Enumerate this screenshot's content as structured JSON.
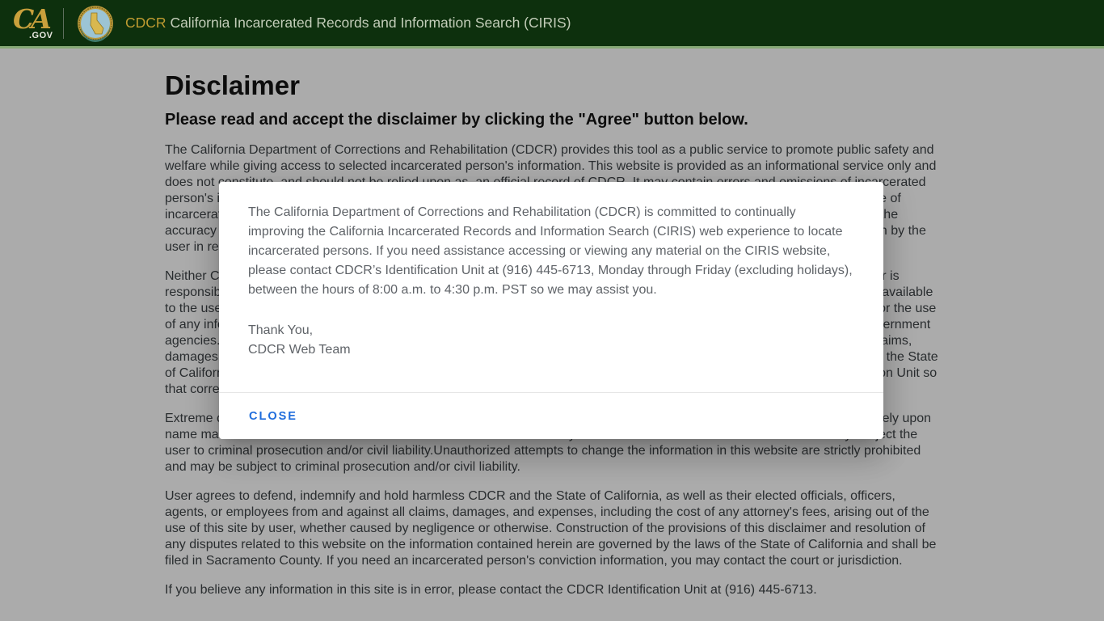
{
  "colors": {
    "header_bg": "#0d300d",
    "header_border": "#86a876",
    "accent_gold": "#bf9b31",
    "brand_text": "#c3cdb9",
    "close_blue": "#1f6ddc"
  },
  "header": {
    "ca_logo_script": "CA",
    "ca_logo_suffix": ".GOV",
    "brand_prefix": "CDCR",
    "brand_title": "California Incarcerated Records and Information Search (CIRIS)"
  },
  "page": {
    "title": "Disclaimer",
    "subtitle": "Please read and accept the disclaimer by clicking the \"Agree\" button below.",
    "paragraphs": [
      "The California Department of Corrections and Rehabilitation (CDCR) provides this tool as a public service to promote public safety and welfare while giving access to selected incarcerated person's information. This website is provided as an informational service only and does not constitute, and should not be relied upon as, an official record of CDCR. It may contain errors and omissions of incarcerated person's information, including but not limited to conviction county, admitted date, current location, and scheduled release date of incarcerated persons. While CDCR attempts to keep this information accurate and current, CDCR makes no guarantee as to the accuracy or completeness of the information provided herein, and assumes no liability for any decisions made or actions taken by the user in reliance upon the information contained in this website.",
      "Neither CDCR nor the State of California guarantees the accuracy, completeness, or timeliness of this information, and neither is responsible for any defects, errors, or omissions in this website or in the information that it provides. This information is made available to the user as is, without warranty of any kind, and by using this website the user shall assume all responsibility and all risks for the use of any information found herein. Any data collected, given at the consent of the user, may be shared with other authorized government agencies. CDCR, the State of California, and their elected officials, officers, agents, or employees shall not be liable for any claims, damages, or losses arising out of the use of, or the inability to use, this website. These provisions are governed by the laws of the State of California, and any errors or omissions in the information found on this website should be reported to the CDCR Identification Unit so that corrections can be made to the information contained in this website.",
      "Extreme care should be used when relying on any information in this website for identification purposes, as identity relying solely upon name matches cannot be confirmed. Misuse or unauthorized use of any of the information contained in this website may subject the user to criminal prosecution and/or civil liability.Unauthorized attempts to change the information in this website are strictly prohibited and may be subject to criminal prosecution and/or civil liability.",
      "User agrees to defend, indemnify and hold harmless CDCR and the State of California, as well as their elected officials, officers, agents, or employees from and against all claims, damages, and expenses, including the cost of any attorney's fees, arising out of the use of this site by user, whether caused by negligence or otherwise. Construction of the provisions of this disclaimer and resolution of any disputes related to this website on the information contained herein are governed by the laws of the State of California and shall be filed in Sacramento County. If you need an incarcerated person's conviction information, you may contact the court or jurisdiction.",
      "If you believe any information in this site is in error, please contact the CDCR Identification Unit at (916) 445-6713."
    ]
  },
  "modal": {
    "body": "The California Department of Corrections and Rehabilitation (CDCR) is committed to continually improving the California Incarcerated Records and Information Search (CIRIS) web experience to locate incarcerated persons. If you need assistance accessing or viewing any material on the CIRIS website, please contact CDCR’s Identification Unit at (916) 445-6713, Monday through Friday (excluding holidays), between the hours of 8:00 a.m. to 4:30 p.m. PST so we may assist you.",
    "signoff_line1": "Thank You,",
    "signoff_line2": "CDCR Web Team",
    "close_label": "CLOSE"
  }
}
